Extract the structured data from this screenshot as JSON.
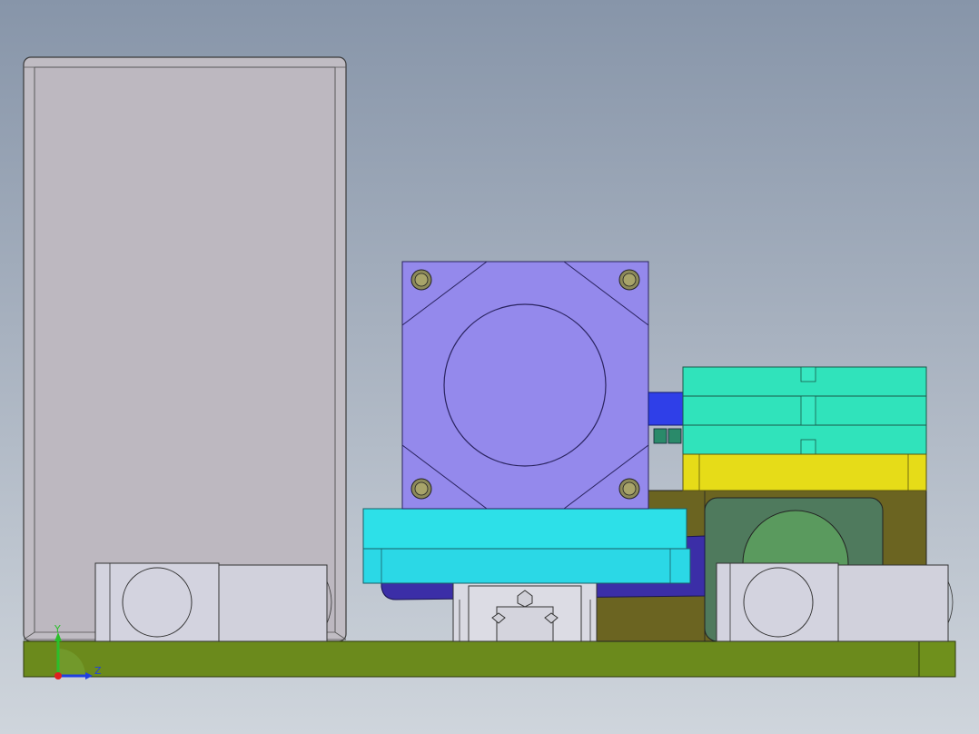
{
  "view": {
    "background_top": "#8795a9",
    "background_bottom": "#cfd5dc"
  },
  "parts": {
    "base_plate": "#6b8a1c",
    "enclosure_box": "#c0bcc3",
    "stepper_motor": "#9489ec",
    "motor_mount_plate": "#2de0e8",
    "support_purple": "#3b2ea7",
    "bracket_olive": "#6b6421",
    "coupling_blue": "#2f3fe8",
    "spacer_plates_teal": "#30e3bb",
    "yellow_block": "#e6dc18",
    "roller_green": "#5a9a5e",
    "bearing_blocks": "#d3d3df",
    "linear_guide": "#d9d9e2"
  },
  "triad": {
    "y_label": "Y",
    "z_label": "Z",
    "x_color": "#e02020",
    "y_color": "#2bbf2b",
    "z_color": "#2040e0"
  }
}
